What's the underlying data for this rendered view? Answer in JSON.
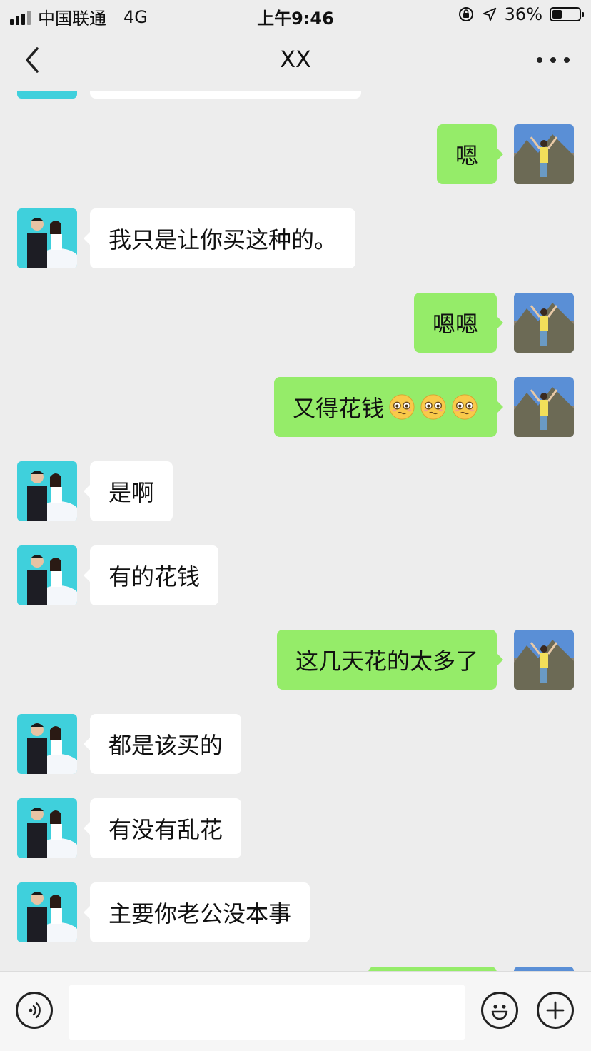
{
  "status_bar": {
    "carrier": "中国联通",
    "network": "4G",
    "time": "上午9:46",
    "battery_percent": "36%",
    "battery_level": 0.36
  },
  "nav": {
    "title": "XX",
    "back_icon": "chevron-left-icon",
    "more_icon": "more-dots-icon"
  },
  "messages": [
    {
      "side": "out",
      "text": "嗯"
    },
    {
      "side": "in",
      "text": "我只是让你买这种的。"
    },
    {
      "side": "out",
      "text": "嗯嗯"
    },
    {
      "side": "out",
      "text": "又得花钱",
      "emoji_count": 3,
      "emoji": "pleading-face-icon"
    },
    {
      "side": "in",
      "text": "是啊"
    },
    {
      "side": "in",
      "text": "有的花钱"
    },
    {
      "side": "out",
      "text": "这几天花的太多了"
    },
    {
      "side": "in",
      "text": "都是该买的"
    },
    {
      "side": "in",
      "text": "有没有乱花"
    },
    {
      "side": "in",
      "text": "主要你老公没本事"
    }
  ],
  "input_bar": {
    "value": "",
    "voice_icon": "voice-icon",
    "emoji_icon": "emoji-icon",
    "plus_icon": "plus-icon"
  },
  "colors": {
    "background": "#ededed",
    "incoming_bubble": "#ffffff",
    "outgoing_bubble": "#95ec69"
  }
}
